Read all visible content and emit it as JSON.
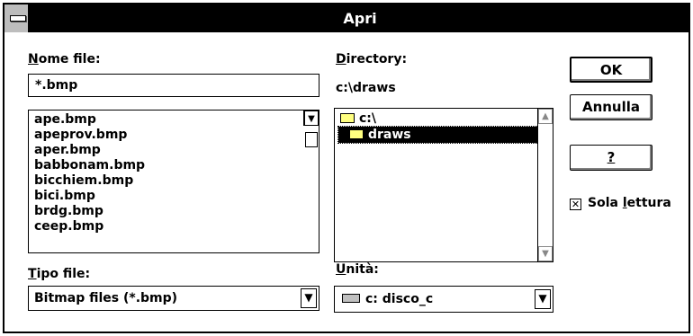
{
  "window": {
    "title": "Apri"
  },
  "file_name": {
    "label_first": "N",
    "label_rest": "ome file:",
    "value": "*.bmp",
    "files": [
      "ape.bmp",
      "apeprov.bmp",
      "aper.bmp",
      "babbonam.bmp",
      "bicchiem.bmp",
      "bici.bmp",
      "brdg.bmp",
      "ceep.bmp"
    ]
  },
  "directory": {
    "label_first": "D",
    "label_rest": "irectory:",
    "current": "c:\\draws",
    "items": [
      "c:\\",
      "draws"
    ]
  },
  "file_type": {
    "label_first": "T",
    "label_rest": "ipo file:",
    "value": "Bitmap files (*.bmp)"
  },
  "drive": {
    "label_first": "U",
    "label_rest": "nità:",
    "value": "c: disco_c"
  },
  "buttons": {
    "ok": "OK",
    "cancel": "Annulla",
    "help": "?"
  },
  "read_only": {
    "label_pre": "Sola ",
    "label_u": "l",
    "label_post": "ettura",
    "checked": true,
    "mark": "✕"
  }
}
